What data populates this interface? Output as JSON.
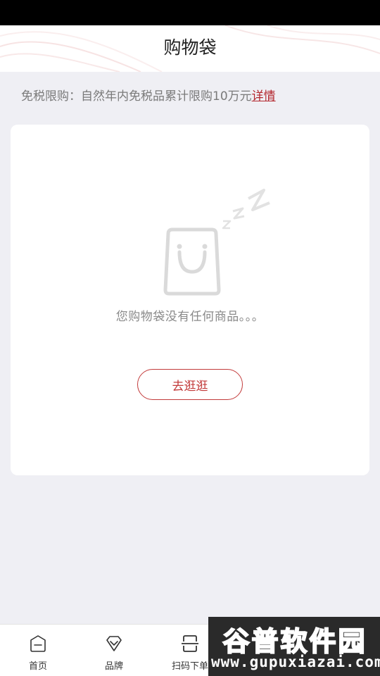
{
  "header": {
    "title": "购物袋"
  },
  "notice": {
    "text": "免税限购：自然年内免税品累计限购10万元",
    "link_label": "详情"
  },
  "empty_state": {
    "message": "您购物袋没有任何商品。。。",
    "button_label": "去逛逛",
    "icon": "empty-shopping-bag-sleeping"
  },
  "tab_bar": {
    "tabs": [
      {
        "label": "首页",
        "icon": "home-icon"
      },
      {
        "label": "品牌",
        "icon": "brand-icon"
      },
      {
        "label": "扫码下单",
        "icon": "scan-icon"
      }
    ]
  },
  "watermark": {
    "title": "谷普软件园",
    "url": "www.gupuxiazai.com"
  },
  "colors": {
    "accent": "#c23a3a",
    "link": "#b3262d",
    "background": "#efeff4"
  }
}
